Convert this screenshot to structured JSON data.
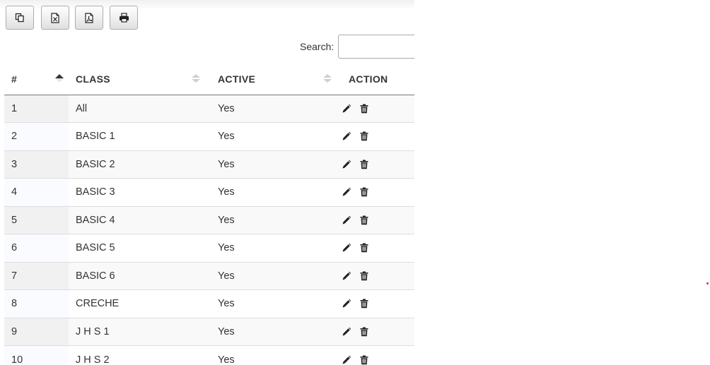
{
  "toolbar": {
    "buttons": [
      {
        "name": "copy-button",
        "icon": "copy-icon"
      },
      {
        "name": "excel-button",
        "icon": "excel-file-icon"
      },
      {
        "name": "pdf-button",
        "icon": "pdf-file-icon"
      },
      {
        "name": "print-button",
        "icon": "print-icon"
      }
    ]
  },
  "search": {
    "label": "Search:",
    "value": "",
    "placeholder": ""
  },
  "table": {
    "columns": [
      {
        "label": "#",
        "sort": "ascending"
      },
      {
        "label": "CLASS",
        "sort": "both"
      },
      {
        "label": "ACTIVE",
        "sort": "both"
      },
      {
        "label": "ACTION",
        "sort": "none"
      }
    ],
    "rows": [
      {
        "num": "1",
        "class": "All",
        "active": "Yes"
      },
      {
        "num": "2",
        "class": "BASIC 1",
        "active": "Yes"
      },
      {
        "num": "3",
        "class": "BASIC 2",
        "active": "Yes"
      },
      {
        "num": "4",
        "class": "BASIC 3",
        "active": "Yes"
      },
      {
        "num": "5",
        "class": "BASIC 4",
        "active": "Yes"
      },
      {
        "num": "6",
        "class": "BASIC 5",
        "active": "Yes"
      },
      {
        "num": "7",
        "class": "BASIC 6",
        "active": "Yes"
      },
      {
        "num": "8",
        "class": "CRECHE",
        "active": "Yes"
      },
      {
        "num": "9",
        "class": "J H S 1",
        "active": "Yes"
      },
      {
        "num": "10",
        "class": "J H S 2",
        "active": "Yes"
      }
    ],
    "row_actions": [
      "edit-icon",
      "delete-icon"
    ]
  },
  "colors": {
    "header_border": "#777777",
    "row_border": "#dddddd",
    "striped_row": "#f9f9f9",
    "text": "#333333"
  }
}
